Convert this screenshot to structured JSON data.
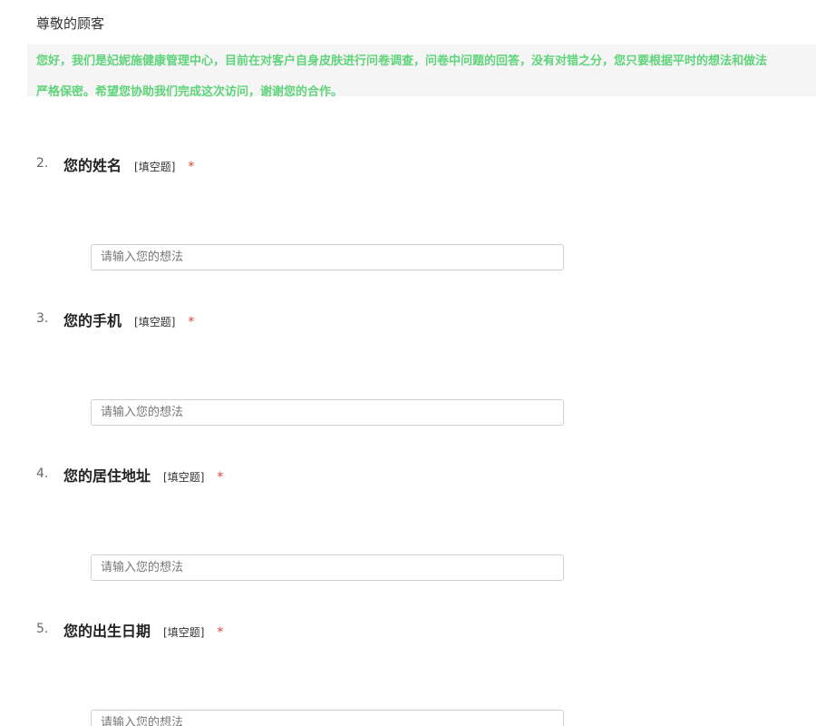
{
  "header": {
    "greeting": "尊敬的顾客",
    "intro_line1": "您好，我们是妃妮施健康管理中心，目前在对客户自身皮肤进行问卷调查，问卷中问题的回答，没有对错之分，您只要根据平时的想法和做法",
    "intro_line2": "严格保密。希望您协助我们完成这次访问，谢谢您的合作。"
  },
  "questions": [
    {
      "number": "2.",
      "title": "您的姓名",
      "type": "[填空题]",
      "required": "*",
      "placeholder": "请输入您的想法",
      "value": ""
    },
    {
      "number": "3.",
      "title": "您的手机",
      "type": "[填空题]",
      "required": "*",
      "placeholder": "请输入您的想法",
      "value": ""
    },
    {
      "number": "4.",
      "title": "您的居住地址",
      "type": "[填空题]",
      "required": "*",
      "placeholder": "请输入您的想法",
      "value": ""
    },
    {
      "number": "5.",
      "title": "您的出生日期",
      "type": "[填空题]",
      "required": "*",
      "placeholder": "请输入您的想法",
      "value": ""
    }
  ],
  "colors": {
    "intro_text": "#5fd47a",
    "intro_background": "#f5f5f5",
    "required_mark": "#e03c3c",
    "input_border": "#cfcfcf"
  }
}
